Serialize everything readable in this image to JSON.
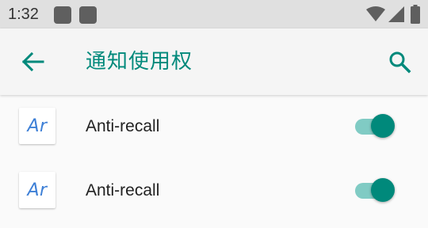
{
  "status_bar": {
    "time": "1:32",
    "icons": [
      "notification-icon",
      "notification-icon",
      "wifi-icon",
      "cellular-icon",
      "battery-icon"
    ]
  },
  "app_bar": {
    "back_icon": "arrow-back-icon",
    "title": "通知使用权",
    "search_icon": "search-icon"
  },
  "colors": {
    "accent": "#00897b",
    "accent_light": "#80cbc4",
    "icon_text": "#3d7fd6"
  },
  "apps": [
    {
      "icon_text": "Ar",
      "name": "Anti-recall",
      "enabled": true
    },
    {
      "icon_text": "Ar",
      "name": "Anti-recall",
      "enabled": true
    }
  ]
}
